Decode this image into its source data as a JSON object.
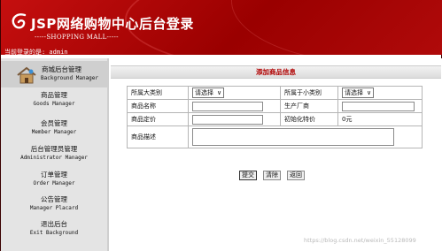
{
  "header": {
    "logo_title": "JSP网络购物中心后台登录",
    "logo_subtitle": "-----SHOPPING MALL-----",
    "brand_color": "#b00000"
  },
  "userbar": {
    "label": "当前登录的是: admin"
  },
  "sidebar": {
    "items": [
      {
        "cn": "商城后台管理",
        "en": "Background Manager",
        "active": true,
        "icon": "home-icon"
      },
      {
        "cn": "商品管理",
        "en": "Goods Manager"
      },
      {
        "cn": "会员管理",
        "en": "Member Manager"
      },
      {
        "cn": "后台管理员管理",
        "en": "Administrator Manager"
      },
      {
        "cn": "订单管理",
        "en": "Order Manager"
      },
      {
        "cn": "公告管理",
        "en": "Manager Placard"
      },
      {
        "cn": "退出后台",
        "en": "Exit Background"
      }
    ]
  },
  "panel": {
    "title": "添加商品信息"
  },
  "form": {
    "big_category_label": "所属大类别",
    "big_category_value": "请选择",
    "small_category_label": "所属于小类别",
    "small_category_value": "请选择",
    "name_label": "商品名称",
    "name_value": "",
    "maker_label": "生产厂商",
    "maker_value": "",
    "price_label": "商品定价",
    "price_value": "",
    "special_label": "初始化特价",
    "special_value": "0元",
    "desc_label": "商品描述",
    "desc_value": ""
  },
  "buttons": {
    "submit": "提交",
    "clear": "清除",
    "back": "返回"
  },
  "watermark": "https://blog.csdn.net/weixin_55128099"
}
